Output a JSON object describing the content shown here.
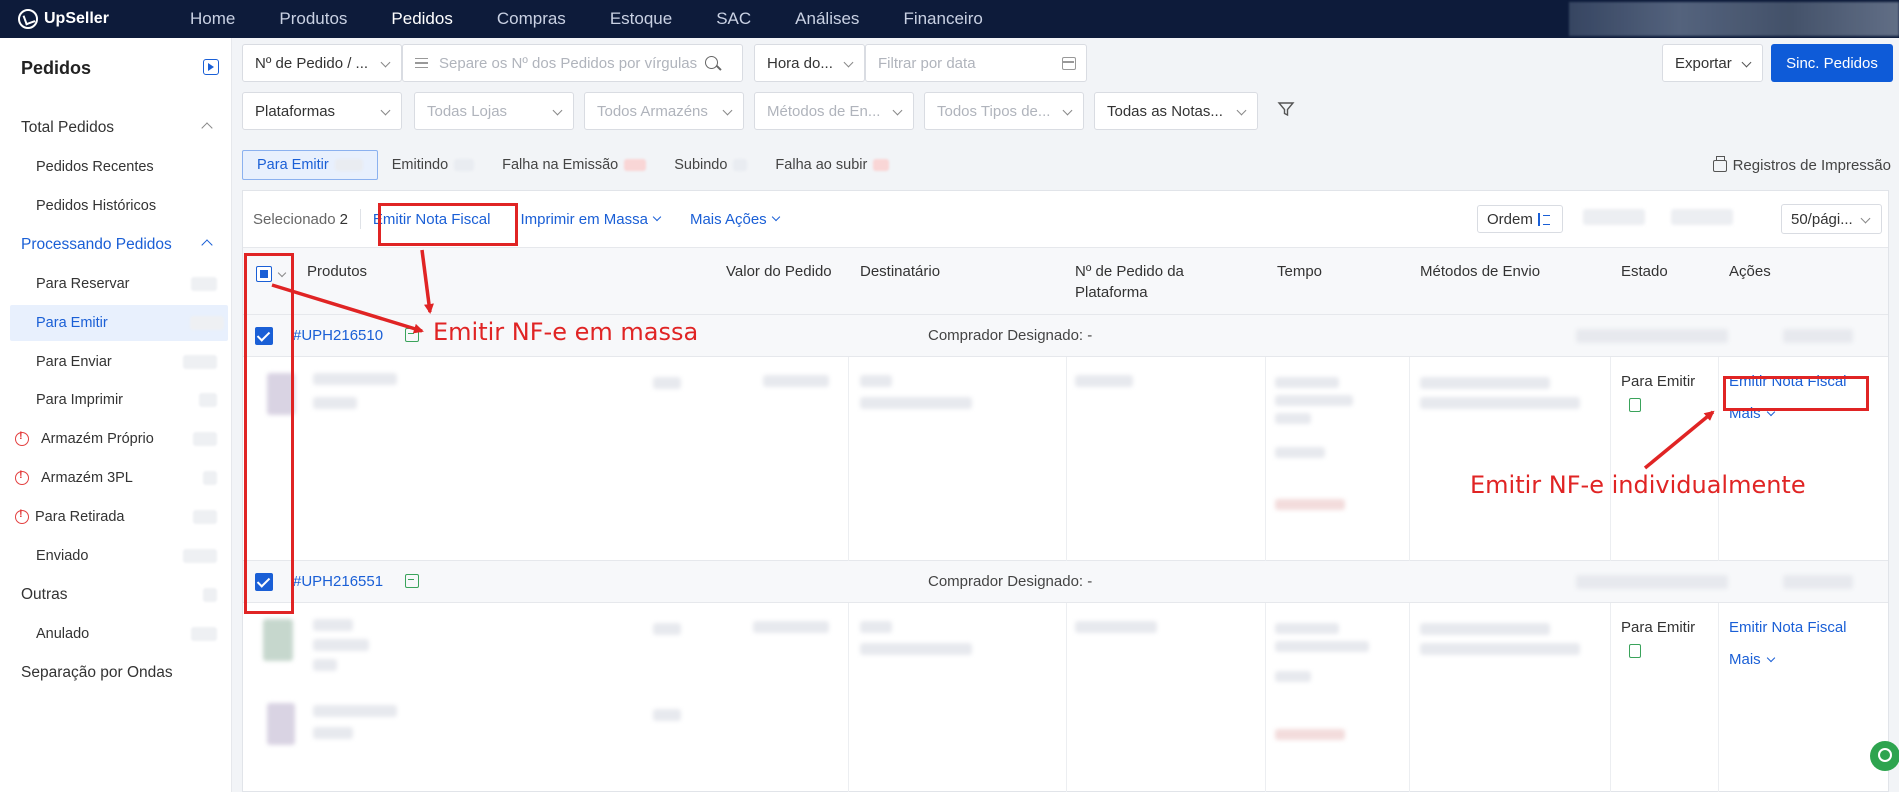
{
  "app": {
    "name": "UpSeller"
  },
  "nav": {
    "items": [
      "Home",
      "Produtos",
      "Pedidos",
      "Compras",
      "Estoque",
      "SAC",
      "Análises",
      "Financeiro"
    ],
    "active": "Pedidos"
  },
  "sidebar": {
    "title": "Pedidos",
    "total_pedidos": "Total Pedidos",
    "pedidos_recentes": "Pedidos Recentes",
    "pedidos_historicos": "Pedidos Históricos",
    "processando": "Processando Pedidos",
    "para_reservar": "Para Reservar",
    "para_emitir": "Para Emitir",
    "para_enviar": "Para Enviar",
    "para_imprimir": "Para Imprimir",
    "armazem_proprio": "Armazém Próprio",
    "armazem_3pl": "Armazém 3PL",
    "para_retirada": "Para Retirada",
    "enviado": "Enviado",
    "outras": "Outras",
    "anulado": "Anulado",
    "separacao": "Separação por Ondas"
  },
  "filters": {
    "order_no_select": "Nº de Pedido / ...",
    "search_placeholder": "Separe os Nº dos Pedidos por vírgulas",
    "time_select": "Hora do...",
    "date_placeholder": "Filtrar por data",
    "plataformas": "Plataformas",
    "lojas": "Todas Lojas",
    "armazens": "Todos Armazéns",
    "metodos": "Métodos de En...",
    "tipos": "Todos Tipos de...",
    "notas": "Todas as Notas..."
  },
  "header_buttons": {
    "exportar": "Exportar",
    "sinc": "Sinc. Pedidos"
  },
  "tabs": [
    "Para Emitir",
    "Emitindo",
    "Falha na Emissão",
    "Subindo",
    "Falha ao subir"
  ],
  "registros": "Registros de Impressão",
  "toolbar": {
    "selecionado": "Selecionado",
    "selected_count": "2",
    "emitir_nota": "Emitir Nota Fiscal",
    "imprimir_massa": "Imprimir em Massa",
    "mais_acoes": "Mais Ações",
    "ordem": "Ordem",
    "per_page": "50/pági..."
  },
  "columns": {
    "produtos": "Produtos",
    "valor": "Valor do Pedido",
    "destinatario": "Destinatário",
    "num_plataforma": "Nº de Pedido da Plataforma",
    "tempo": "Tempo",
    "metodos_envio": "Métodos de Envio",
    "estado": "Estado",
    "acoes": "Ações"
  },
  "orders": [
    {
      "id": "#UPH216510",
      "buyer_label": "Comprador Designado:",
      "buyer_value": "-",
      "status": "Para Emitir",
      "action": "Emitir Nota Fiscal",
      "more": "Mais"
    },
    {
      "id": "#UPH216551",
      "buyer_label": "Comprador Designado:",
      "buyer_value": "-",
      "status": "Para Emitir",
      "action": "Emitir Nota Fiscal",
      "more": "Mais"
    }
  ],
  "annotations": {
    "massa": "Emitir NF-e em massa",
    "individual": "Emitir NF-e individualmente"
  },
  "colors": {
    "primary": "#0e5bd8",
    "annotation": "#e02424",
    "topbar": "#0d1b3a"
  }
}
